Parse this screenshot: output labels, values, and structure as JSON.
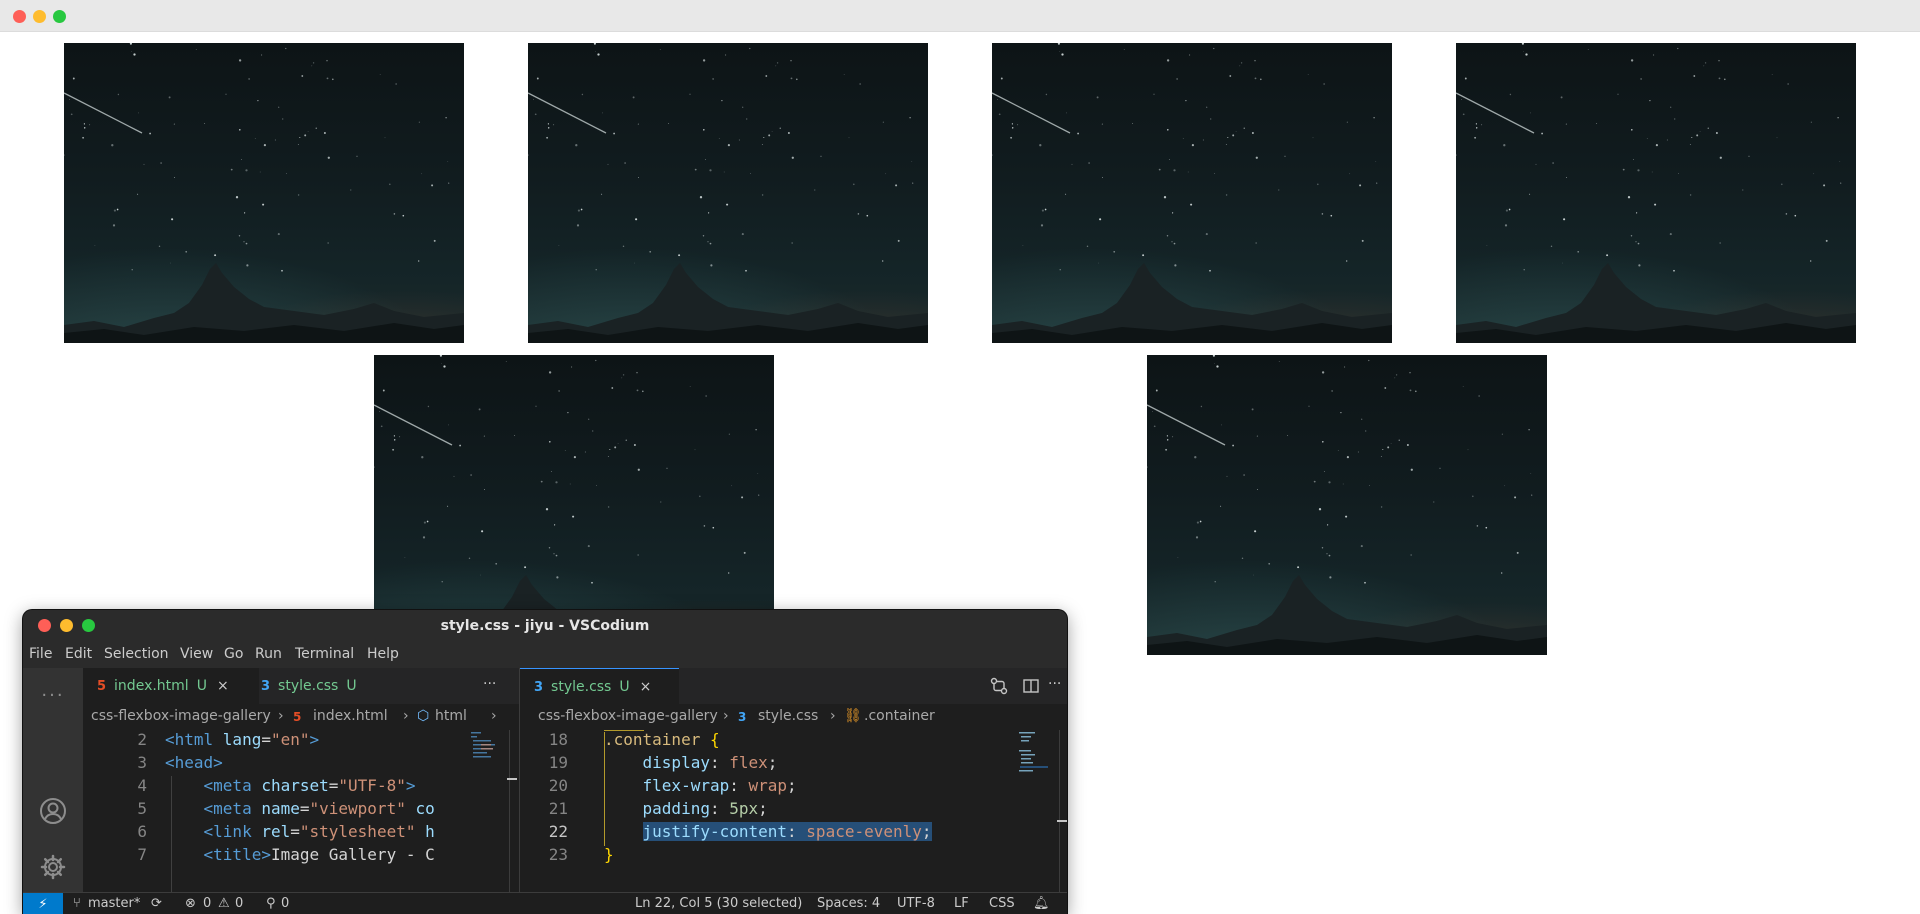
{
  "browser": {
    "controls": [
      "close",
      "minimize",
      "maximize"
    ]
  },
  "gallery": {
    "images": [
      {
        "name": "mountain-night-sky-photo"
      },
      {
        "name": "mountain-night-sky-photo"
      },
      {
        "name": "mountain-night-sky-photo"
      },
      {
        "name": "mountain-night-sky-photo"
      },
      {
        "name": "mountain-night-sky-photo"
      },
      {
        "name": "mountain-night-sky-photo"
      }
    ]
  },
  "editor": {
    "window_title": "style.css - jiyu - VSCodium",
    "menu": [
      "File",
      "Edit",
      "Selection",
      "View",
      "Go",
      "Run",
      "Terminal",
      "Help"
    ],
    "left_group": {
      "tabs": [
        {
          "icon": "html5-icon",
          "label": "index.html",
          "status": "U",
          "close": "×"
        },
        {
          "icon": "css3-icon",
          "label": "style.css",
          "status": "U"
        }
      ],
      "more": "···",
      "breadcrumb": [
        "css-flexbox-image-gallery",
        "index.html",
        "html"
      ],
      "lines": [
        {
          "n": "2",
          "indent": "",
          "parts": [
            [
              "tag",
              "<html "
            ],
            [
              "attr",
              "lang"
            ],
            [
              "txt",
              "="
            ],
            [
              "str",
              "\"en\""
            ],
            [
              "tag",
              ">"
            ]
          ]
        },
        {
          "n": "3",
          "indent": "",
          "parts": [
            [
              "tag",
              "<head>"
            ]
          ]
        },
        {
          "n": "4",
          "indent": "    ",
          "parts": [
            [
              "tag",
              "<meta "
            ],
            [
              "attr",
              "charset"
            ],
            [
              "txt",
              "="
            ],
            [
              "str",
              "\"UTF-8\""
            ],
            [
              "tag",
              ">"
            ]
          ]
        },
        {
          "n": "5",
          "indent": "    ",
          "parts": [
            [
              "tag",
              "<meta "
            ],
            [
              "attr",
              "name"
            ],
            [
              "txt",
              "="
            ],
            [
              "str",
              "\"viewport\" "
            ],
            [
              "attr",
              "co"
            ]
          ]
        },
        {
          "n": "6",
          "indent": "    ",
          "parts": [
            [
              "tag",
              "<link "
            ],
            [
              "attr",
              "rel"
            ],
            [
              "txt",
              "="
            ],
            [
              "str",
              "\"stylesheet\" "
            ],
            [
              "attr",
              "h"
            ]
          ]
        },
        {
          "n": "7",
          "indent": "    ",
          "parts": [
            [
              "tag",
              "<title>"
            ],
            [
              "txt",
              "Image Gallery - C"
            ]
          ]
        }
      ]
    },
    "right_group": {
      "tab": {
        "icon": "css3-icon",
        "label": "style.css",
        "status": "U",
        "close": "×"
      },
      "breadcrumb": [
        "css-flexbox-image-gallery",
        "style.css",
        ".container"
      ],
      "lines": [
        {
          "n": "18",
          "parts": [
            [
              "sel",
              ".container "
            ],
            [
              "brace",
              "{"
            ]
          ]
        },
        {
          "n": "19",
          "parts": [
            [
              "txt",
              "    "
            ],
            [
              "prop",
              "display"
            ],
            [
              "txt",
              ": "
            ],
            [
              "val",
              "flex"
            ],
            [
              "txt",
              ";"
            ]
          ]
        },
        {
          "n": "20",
          "parts": [
            [
              "txt",
              "    "
            ],
            [
              "prop",
              "flex-wrap"
            ],
            [
              "txt",
              ": "
            ],
            [
              "val",
              "wrap"
            ],
            [
              "txt",
              ";"
            ]
          ]
        },
        {
          "n": "21",
          "parts": [
            [
              "txt",
              "    "
            ],
            [
              "prop",
              "padding"
            ],
            [
              "txt",
              ": "
            ],
            [
              "num",
              "5px"
            ],
            [
              "txt",
              ";"
            ]
          ]
        },
        {
          "n": "22",
          "current": true,
          "parts": [
            [
              "txt",
              "    "
            ],
            [
              "prop hl",
              "justify-content"
            ],
            [
              "txt hl",
              ": "
            ],
            [
              "val hl",
              "space-evenly"
            ],
            [
              "txt hl",
              ";"
            ]
          ]
        },
        {
          "n": "23",
          "parts": [
            [
              "brace",
              "}"
            ]
          ]
        }
      ]
    },
    "status": {
      "branch": "master*",
      "errors": "0",
      "warnings": "0",
      "ports": "0",
      "cursor": "Ln 22, Col 5 (30 selected)",
      "spaces": "Spaces: 4",
      "encoding": "UTF-8",
      "eol": "LF",
      "language": "CSS"
    }
  }
}
